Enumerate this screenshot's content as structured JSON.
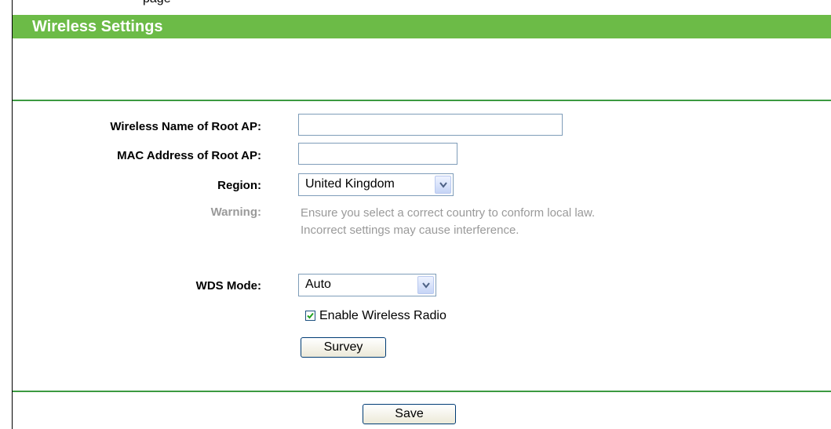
{
  "header": {
    "title": "Wireless Settings"
  },
  "top_fragment": "page",
  "form": {
    "ssid": {
      "label": "Wireless Name of Root AP:",
      "value": ""
    },
    "mac": {
      "label": "MAC Address of Root AP:",
      "value": ""
    },
    "region": {
      "label": "Region:",
      "selected": "United Kingdom"
    },
    "warning": {
      "label": "Warning:",
      "line1": "Ensure you select a correct country to conform local law.",
      "line2": "Incorrect settings may cause interference."
    },
    "wds_mode": {
      "label": "WDS Mode:",
      "selected": "Auto"
    },
    "enable_radio": {
      "label": "Enable Wireless Radio",
      "checked": true
    },
    "survey_button": "Survey"
  },
  "footer": {
    "save_button": "Save"
  },
  "colors": {
    "header_green": "#6cbb47",
    "rule_green": "#3c9a41",
    "muted_text": "#9a9a9a"
  }
}
